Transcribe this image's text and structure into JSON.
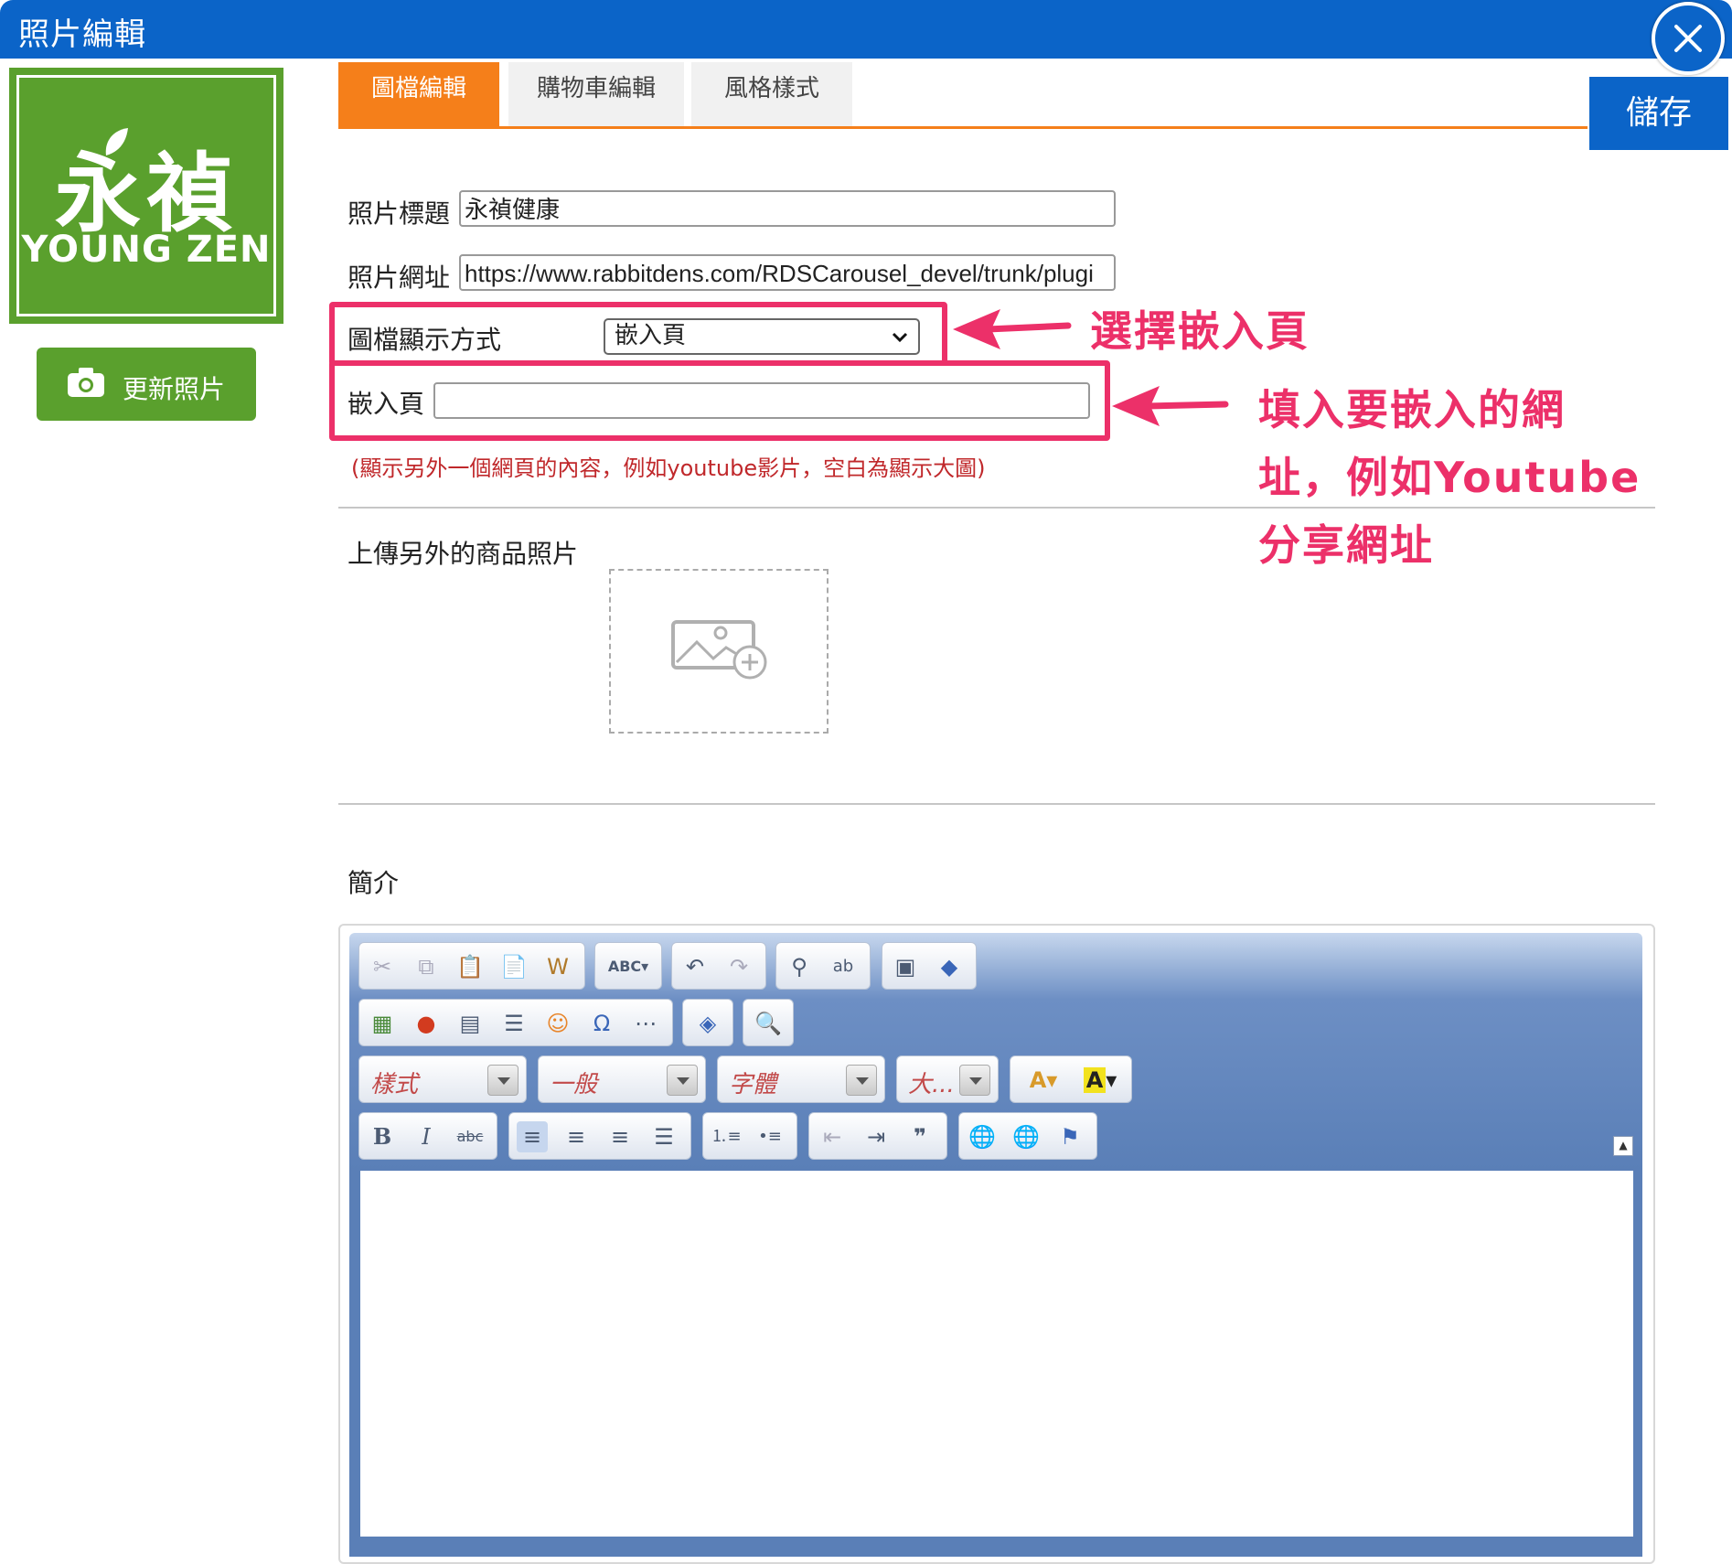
{
  "window": {
    "title": "照片編輯",
    "close_icon": "close-icon",
    "accent_color": "#0b64c8"
  },
  "logo": {
    "chinese": "永禎",
    "english": "YOUNG ZEN",
    "color": "#5aa02d"
  },
  "update_photo": {
    "label": "更新照片",
    "icon": "camera-icon"
  },
  "tabs": [
    {
      "label": "圖檔編輯",
      "active": true
    },
    {
      "label": "購物車編輯",
      "active": false
    },
    {
      "label": "風格樣式",
      "active": false
    }
  ],
  "save_label": "儲存",
  "form": {
    "photo_title_label": "照片標題",
    "photo_title_value": "永禎健康",
    "photo_url_label": "照片網址",
    "photo_url_value": "https://www.rabbitdens.com/RDSCarousel_devel/trunk/plugi",
    "display_label": "圖檔顯示方式",
    "display_selected": "嵌入頁",
    "embed_label": "嵌入頁",
    "embed_value": "",
    "embed_hint": "(顯示另外一個網頁的內容，例如youtube影片，空白為顯示大圖)",
    "upload_label": "上傳另外的商品照片",
    "intro_label": "簡介"
  },
  "annotations": {
    "select_embed": "選擇嵌入頁",
    "fill_line1": "填入要嵌入的網",
    "fill_line2": "址，例如Youtube",
    "fill_line3": "分享網址",
    "color": "#ec3069"
  },
  "editor": {
    "style_combo": "樣式",
    "format_combo": "一般",
    "font_combo": "字體",
    "size_combo": "大...",
    "toolbar_icons_row1": [
      "cut-icon",
      "copy-icon",
      "paste-icon",
      "paste-text-icon",
      "paste-word-icon",
      "spellcheck-icon",
      "undo-icon",
      "redo-icon",
      "find-icon",
      "replace-icon",
      "select-all-icon",
      "remove-format-icon"
    ],
    "toolbar_icons_row2": [
      "image-icon",
      "flash-icon",
      "table-icon",
      "horizontal-rule-icon",
      "smiley-icon",
      "special-char-icon",
      "page-break-icon",
      "maximize-icon",
      "preview-icon"
    ],
    "toolbar_icons_row4": [
      "bold-icon",
      "italic-icon",
      "strikethrough-icon",
      "align-left-icon",
      "align-center-icon",
      "align-right-icon",
      "justify-icon",
      "numbered-list-icon",
      "bulleted-list-icon",
      "outdent-icon",
      "indent-icon",
      "blockquote-icon",
      "link-icon",
      "unlink-icon",
      "anchor-icon"
    ]
  }
}
